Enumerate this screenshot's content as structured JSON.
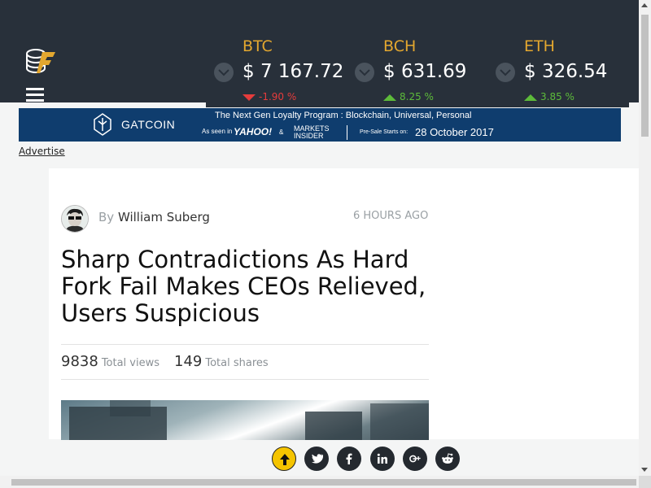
{
  "tickers": [
    {
      "symbol": "BTC",
      "price": "$ 7 167.72",
      "change": "-1.90 %",
      "direction": "down"
    },
    {
      "symbol": "BCH",
      "price": "$ 631.69",
      "change": "8.25 %",
      "direction": "up"
    },
    {
      "symbol": "ETH",
      "price": "$ 326.54",
      "change": "3.85 %",
      "direction": "up"
    }
  ],
  "banner": {
    "brand": "GATCOIN",
    "program": "The Next Gen Loyalty Program :  Blockchain, Universal, Personal",
    "seen": "As seen in",
    "yahoo": "YAHOO!",
    "amp": "&",
    "markets": "MARKETS",
    "insider": "INSIDER",
    "presale": "Pre-Sale Starts on:",
    "date": "28 October 2017"
  },
  "advertise_link": "Advertise",
  "article": {
    "by": "By",
    "author": "William Suberg",
    "time": "6 HOURS AGO",
    "title": "Sharp Contradictions As Hard Fork Fail Makes CEOs Relieved, Users Suspicious",
    "views_count": "9838",
    "views_label": "Total views",
    "shares_count": "149",
    "shares_label": "Total shares"
  },
  "share_icons": [
    "scroll-top-icon",
    "twitter-icon",
    "facebook-icon",
    "linkedin-icon",
    "google-plus-icon",
    "reddit-icon"
  ],
  "colors": {
    "header_bg": "#28303a",
    "accent": "#e3a72f",
    "down": "#e53c3c",
    "up": "#5dbb3a",
    "banner_bg": "#0f3d6e"
  }
}
